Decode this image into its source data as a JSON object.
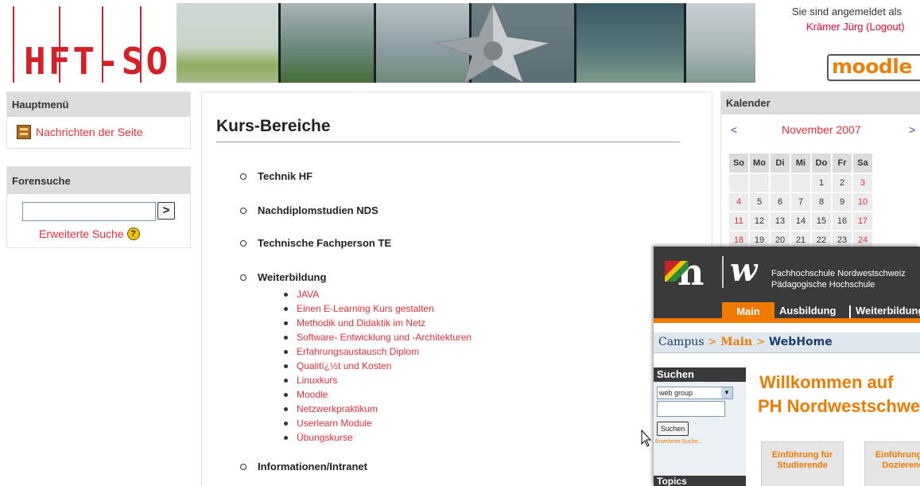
{
  "header": {
    "logo_text": "HFT-SO",
    "login_text": "Sie sind angemeldet als",
    "login_user": "Krämer Jürg (Logout)",
    "moodle_logo": "moodle"
  },
  "left": {
    "main_menu_title": "Hauptmenü",
    "main_menu_item": "Nachrichten der Seite",
    "forum_search_title": "Forensuche",
    "forum_search_button": ">",
    "advanced_search": "Erweiterte Suche",
    "help_icon": "help-icon"
  },
  "main": {
    "title": "Kurs-Bereiche",
    "categories": [
      "Technik HF",
      "Nachdiplomstudien NDS",
      "Technische Fachperson TE",
      "Weiterbildung",
      "Informationen/Intranet"
    ],
    "weiterbildung_courses": [
      "JAVA",
      "Einen E-Learning Kurs gestalten",
      "Methodik und Didaktik im Netz",
      "Software- Entwicklung und -Architekturen",
      "Erfahrungsaustausch Diplom",
      "Qualitï¿½t und Kosten",
      "Linuxkurs",
      "Moodle",
      "Netzwerkpraktikum",
      "Userlearn Module",
      "Übungskurse"
    ]
  },
  "calendar": {
    "title": "Kalender",
    "prev": "<",
    "month": "November 2007",
    "next": ">",
    "weekdays": [
      "So",
      "Mo",
      "Di",
      "Mi",
      "Do",
      "Fr",
      "Sa"
    ],
    "weeks": [
      [
        "",
        "",
        "",
        "",
        "1",
        "2",
        "3"
      ],
      [
        "4",
        "5",
        "6",
        "7",
        "8",
        "9",
        "10"
      ],
      [
        "11",
        "12",
        "13",
        "14",
        "15",
        "16",
        "17"
      ],
      [
        "18",
        "19",
        "20",
        "21",
        "22",
        "23",
        "24"
      ]
    ],
    "colors": {
      "weekend": "#e8303a"
    }
  },
  "overlay": {
    "logo_n": "n",
    "logo_w": "w",
    "school_line1": "Fachhochschule Nordwestschweiz",
    "school_line2": "Pädagogische Hochschule",
    "nav": {
      "main": "Main",
      "ausbildung": "Ausbildung",
      "weiterbildung": "Weiterbildung"
    },
    "breadcrumb": {
      "campus": "Campus",
      "sep1": " > ",
      "main": "Main",
      "sep2": " > ",
      "page": "WebHome"
    },
    "search": {
      "title": "Suchen",
      "scope": "web group",
      "button": "Suchen",
      "extended": "Erweiterte Suche..."
    },
    "topics_title": "Topics",
    "welcome_line1": "Willkommen auf",
    "welcome_line2": "PH Nordwestschweiz",
    "cards": [
      "Einführung für Studierende",
      "Einführung für Dozierende"
    ],
    "colors": {
      "accent": "#f07a00",
      "dark": "#3a3a3a"
    }
  }
}
